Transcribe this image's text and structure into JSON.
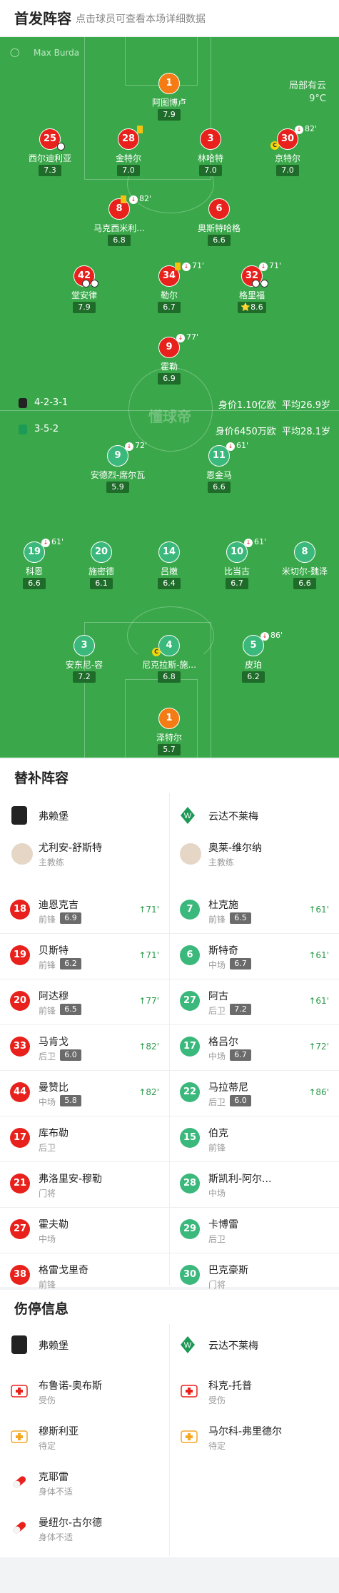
{
  "header": {
    "title": "首发阵容",
    "subtitle": "点击球员可查看本场详细数据"
  },
  "pitch": {
    "referee": "Max Burda",
    "weather_1": "局部有云",
    "weather_2": "9°C",
    "watermark": "懂球帝",
    "home_formation": "4-2-3-1",
    "home_value": "身价1.10亿欧",
    "home_age": "平均26.9岁",
    "away_formation": "3-5-2",
    "away_value": "身价6450万欧",
    "away_age": "平均28.1岁"
  },
  "home_players": [
    {
      "num": "1",
      "name": "阿图博卢",
      "rating": "7.9"
    },
    {
      "num": "25",
      "name": "西尔迪利亚",
      "rating": "7.3"
    },
    {
      "num": "28",
      "name": "金特尔",
      "rating": "7.0"
    },
    {
      "num": "3",
      "name": "林哈特",
      "rating": "7.0"
    },
    {
      "num": "30",
      "name": "京特尔",
      "rating": "7.0",
      "sub": "82'"
    },
    {
      "num": "8",
      "name": "马克西米利...",
      "rating": "6.8",
      "sub": "82'"
    },
    {
      "num": "6",
      "name": "奥斯特哈格",
      "rating": "6.6"
    },
    {
      "num": "42",
      "name": "堂安律",
      "rating": "7.9"
    },
    {
      "num": "34",
      "name": "勒尔",
      "rating": "6.7",
      "sub": "71'"
    },
    {
      "num": "32",
      "name": "格里福",
      "rating": "8.6",
      "sub": "71'"
    },
    {
      "num": "9",
      "name": "霍勒",
      "rating": "6.9",
      "sub": "77'"
    }
  ],
  "away_players": [
    {
      "num": "9",
      "name": "安德烈-席尔瓦",
      "rating": "5.9",
      "sub": "72'"
    },
    {
      "num": "11",
      "name": "恩金马",
      "rating": "6.6",
      "sub": "61'"
    },
    {
      "num": "19",
      "name": "科恩",
      "rating": "6.6",
      "sub": "61'"
    },
    {
      "num": "20",
      "name": "施密德",
      "rating": "6.1"
    },
    {
      "num": "14",
      "name": "吕嫩",
      "rating": "6.4"
    },
    {
      "num": "10",
      "name": "比当古",
      "rating": "6.7",
      "sub": "61'"
    },
    {
      "num": "8",
      "name": "米切尔-魏泽",
      "rating": "6.6"
    },
    {
      "num": "3",
      "name": "安东尼-容",
      "rating": "7.2"
    },
    {
      "num": "4",
      "name": "尼克拉斯-施...",
      "rating": "6.8"
    },
    {
      "num": "5",
      "name": "皮珀",
      "rating": "6.2",
      "sub": "86'"
    },
    {
      "num": "1",
      "name": "泽特尔",
      "rating": "5.7"
    }
  ],
  "subs": {
    "title": "替补阵容",
    "home_team": "弗赖堡",
    "away_team": "云达不莱梅",
    "home_coach": "尤利安-舒斯特",
    "away_coach": "奥莱-维尔纳",
    "coach_label": "主教练",
    "home": [
      {
        "num": "18",
        "name": "迪恩克吉",
        "pos": "前锋",
        "rating": "6.9",
        "in": "71'"
      },
      {
        "num": "19",
        "name": "贝斯特",
        "pos": "前锋",
        "rating": "6.2",
        "in": "71'"
      },
      {
        "num": "20",
        "name": "阿达穆",
        "pos": "前锋",
        "rating": "6.5",
        "in": "77'"
      },
      {
        "num": "33",
        "name": "马肯戈",
        "pos": "后卫",
        "rating": "6.0",
        "in": "82'"
      },
      {
        "num": "44",
        "name": "曼赞比",
        "pos": "中场",
        "rating": "5.8",
        "in": "82'"
      },
      {
        "num": "17",
        "name": "库布勒",
        "pos": "后卫"
      },
      {
        "num": "21",
        "name": "弗洛里安-穆勒",
        "pos": "门将"
      },
      {
        "num": "27",
        "name": "霍夫勒",
        "pos": "中场"
      },
      {
        "num": "38",
        "name": "格雷戈里奇",
        "pos": "前锋"
      }
    ],
    "away": [
      {
        "num": "7",
        "name": "杜克施",
        "pos": "前锋",
        "rating": "6.5",
        "in": "61'"
      },
      {
        "num": "6",
        "name": "斯特奇",
        "pos": "中场",
        "rating": "6.7",
        "in": "61'"
      },
      {
        "num": "27",
        "name": "阿古",
        "pos": "后卫",
        "rating": "7.2",
        "in": "61'"
      },
      {
        "num": "17",
        "name": "格吕尔",
        "pos": "中场",
        "rating": "6.7",
        "in": "72'"
      },
      {
        "num": "22",
        "name": "马拉蒂尼",
        "pos": "后卫",
        "rating": "6.0",
        "in": "86'"
      },
      {
        "num": "15",
        "name": "伯克",
        "pos": "前锋"
      },
      {
        "num": "28",
        "name": "斯凯利-阿尔...",
        "pos": "中场"
      },
      {
        "num": "29",
        "name": "卡博雷",
        "pos": "后卫"
      },
      {
        "num": "30",
        "name": "巴克豪斯",
        "pos": "门将"
      }
    ]
  },
  "injuries": {
    "title": "伤停信息",
    "home_team": "弗赖堡",
    "away_team": "云达不莱梅",
    "home": [
      {
        "name": "布鲁诺-奥布斯",
        "status": "受伤"
      },
      {
        "name": "穆斯利亚",
        "status": "待定"
      },
      {
        "name": "克耶雷",
        "status": "身体不适"
      },
      {
        "name": "曼纽尔-古尔德",
        "status": "身体不适"
      }
    ],
    "away": [
      {
        "name": "科克-托普",
        "status": "受伤"
      },
      {
        "name": "马尔科-弗里德尔",
        "status": "待定"
      }
    ]
  }
}
